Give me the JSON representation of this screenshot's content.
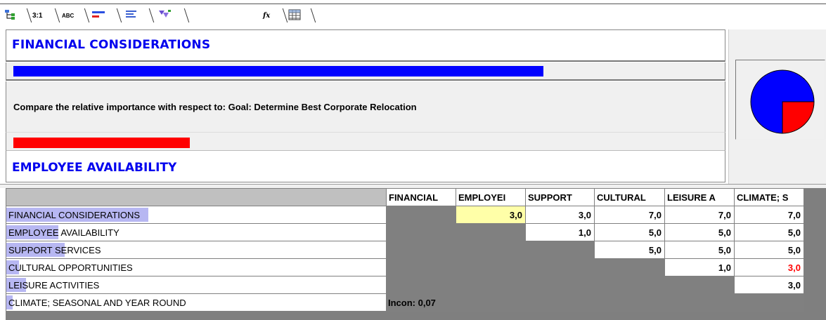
{
  "toolbar": {
    "tabs": [
      {
        "name": "hierarchy",
        "icon": "hierarchy-icon"
      },
      {
        "name": "ratio",
        "label": "3:1"
      },
      {
        "name": "verbal",
        "label": "ABC"
      },
      {
        "name": "graphical",
        "icon": "bar-compare-icon"
      },
      {
        "name": "questionnaire",
        "icon": "lines-icon"
      },
      {
        "name": "tree-filter",
        "icon": "tree-filter-icon"
      },
      {
        "name": "formula",
        "label": "fx"
      },
      {
        "name": "grid",
        "icon": "grid-icon"
      }
    ]
  },
  "comparison": {
    "left_title": "FINANCIAL CONSIDERATIONS",
    "left_bar_fraction": 0.75,
    "left_color": "#0000ff",
    "prompt": "Compare the relative importance with respect to: Goal: Determine Best Corporate Relocation",
    "right_title": "EMPLOYEE AVAILABILITY",
    "right_bar_fraction": 0.25,
    "right_color": "#ff0000",
    "pie": {
      "left_share": 0.75,
      "right_share": 0.25
    }
  },
  "matrix": {
    "columns": [
      "FINANCIAL",
      "EMPLOYEI",
      "SUPPORT",
      "CULTURAL",
      "LEISURE A",
      "CLIMATE; S"
    ],
    "rows": [
      {
        "label": "FINANCIAL CONSIDERATIONS",
        "highlight_chars": 22,
        "cells": [
          "",
          "3,0",
          "3,0",
          "7,0",
          "7,0",
          "7,0"
        ]
      },
      {
        "label": "EMPLOYEE AVAILABILITY",
        "highlight_chars": 8,
        "cells": [
          "",
          "",
          "1,0",
          "5,0",
          "5,0",
          "5,0"
        ]
      },
      {
        "label": "SUPPORT SERVICES",
        "highlight_chars": 9,
        "cells": [
          "",
          "",
          "",
          "5,0",
          "5,0",
          "5,0"
        ]
      },
      {
        "label": "CULTURAL OPPORTUNITIES",
        "highlight_chars": 2,
        "cells": [
          "",
          "",
          "",
          "",
          "1,0",
          "3,0"
        ]
      },
      {
        "label": "LEISURE ACTIVITIES",
        "highlight_chars": 3,
        "cells": [
          "",
          "",
          "",
          "",
          "",
          "3,0"
        ]
      },
      {
        "label": "CLIMATE; SEASONAL AND YEAR ROUND",
        "highlight_chars": 1,
        "cells": [
          "",
          "",
          "",
          "",
          "",
          ""
        ]
      }
    ],
    "selected_cell": {
      "row": 0,
      "col": 1
    },
    "red_cell": {
      "row": 3,
      "col": 5
    },
    "inconsistency": "Incon: 0,07"
  }
}
